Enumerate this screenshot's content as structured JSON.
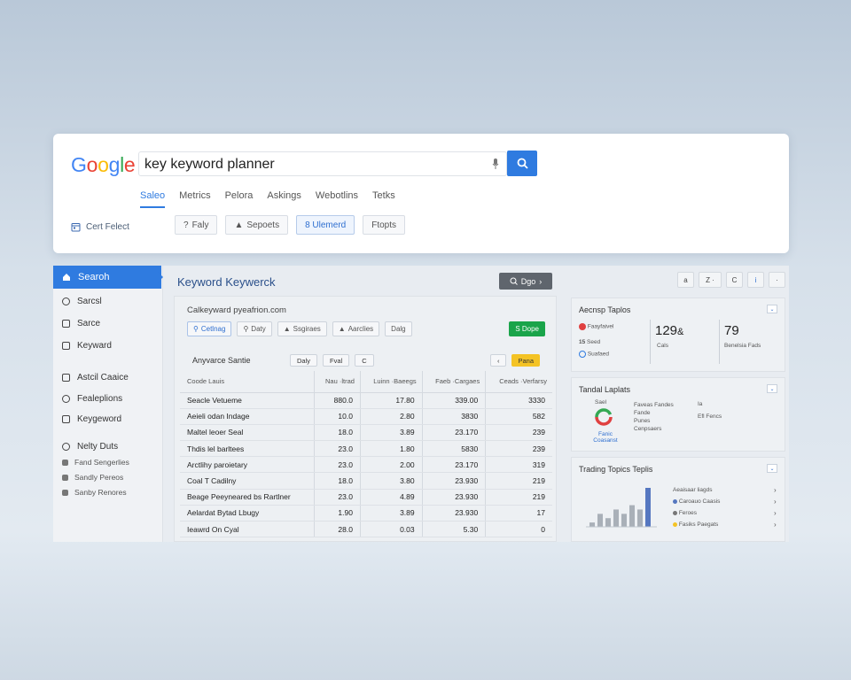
{
  "search_card": {
    "logo": [
      "G",
      "o",
      "o",
      "g",
      "l",
      "e"
    ],
    "logo_colors": [
      "#4285F4",
      "#EA4335",
      "#FBBC05",
      "#4285F4",
      "#34A853",
      "#EA4335"
    ],
    "query": "key keyword planner",
    "tabs": [
      "Saleo",
      "Metrics",
      "Pelora",
      "Askings",
      "Webotlins",
      "Tetks"
    ],
    "cart_select": "Cert Felect",
    "chips": [
      "Faly",
      "Sepoets",
      "8 Ulemerd",
      "Ftopts"
    ]
  },
  "sidebar": {
    "active": "Searoh",
    "items": [
      "Sarcsl",
      "Sarce",
      "Keyward"
    ],
    "items2": [
      "Astcil Caaice",
      "Fealeplions",
      "Keygeword"
    ],
    "items3": [
      "Nelty Duts"
    ],
    "small_items": [
      "Fand Sengerlies",
      "Sandly Pereos",
      "Sanby Renores"
    ]
  },
  "main": {
    "title": "Keyword Keywerck",
    "button": "Dgo",
    "subtitle": "Calkeyward pyeafrion.com",
    "filters": [
      "Cetlnag",
      "Daty",
      "Ssgiraes",
      "Aarclies",
      "Dalg"
    ],
    "green_button": "S Dope",
    "table_title": "Anyvarce Santie",
    "controls": [
      "Daly",
      "Fval",
      "C"
    ],
    "yellow_button": "Pana",
    "headers": [
      "Coode   Lauis",
      "Nau ·ltrad",
      "Luinn ·Baeegs",
      "Faeb ·Cargaes",
      "Ceads ·Verfarsy"
    ],
    "rows": [
      [
        "Seacle Vetueme",
        "880.0",
        "17.80",
        "339.00",
        "3330"
      ],
      [
        "Aeieli odan Indage",
        "10.0",
        "2.80",
        "3830",
        "582"
      ],
      [
        "Maltel leoer Seal",
        "18.0",
        "3.89",
        "23.170",
        "239"
      ],
      [
        "Thdis lel barltees",
        "23.0",
        "1.80",
        "5830",
        "239"
      ],
      [
        "Arctlihy paroietary",
        "23.0",
        "2.00",
        "23.170",
        "319"
      ],
      [
        "Coal T Cadilny",
        "18.0",
        "3.80",
        "23.930",
        "219"
      ],
      [
        "Beage Peeyneared bs Rartlner",
        "23.0",
        "4.89",
        "23.930",
        "219"
      ],
      [
        "Aelardat Bytad Lbugy",
        "1.90",
        "3.89",
        "23.930",
        "17"
      ],
      [
        "Ieawrd On Cyal",
        "28.0",
        "0.03",
        "5.30",
        "0"
      ]
    ]
  },
  "right": {
    "icons": [
      "a",
      "Z ·",
      "C",
      "i",
      "·"
    ],
    "card1": {
      "title": "Aecnsp Taplos",
      "num1": "129",
      "num1_suffix": "&",
      "num2": "79",
      "lines": [
        "Faayfaivel",
        "Seed",
        "Suafaed"
      ],
      "label_a": "Cals",
      "label_b": "Benelsia Fads",
      "line_label": "15"
    },
    "card2": {
      "title": "Tandal Laplats",
      "legend": [
        "Sael",
        "Faveas Fandes",
        "Fande",
        "Punes",
        "Cenpsaers"
      ],
      "donut_label": "Fanic Coasanst",
      "side": [
        "Ia",
        "Efl Fencs"
      ]
    },
    "card3": {
      "title": "Trading Topics Teplis",
      "list": [
        "Aeaisaar liagds",
        "Caroauo Caasis",
        "Feroes",
        "Fasiks Paegats"
      ],
      "bars": [
        1,
        3,
        2,
        4,
        3,
        5,
        4,
        9
      ],
      "bar_color": "#a9b0b8",
      "accent_bar_color": "#5577c0"
    }
  },
  "colors": {
    "accent": "#2f7be0",
    "green": "#1aa44a",
    "yellow": "#f4c325"
  }
}
